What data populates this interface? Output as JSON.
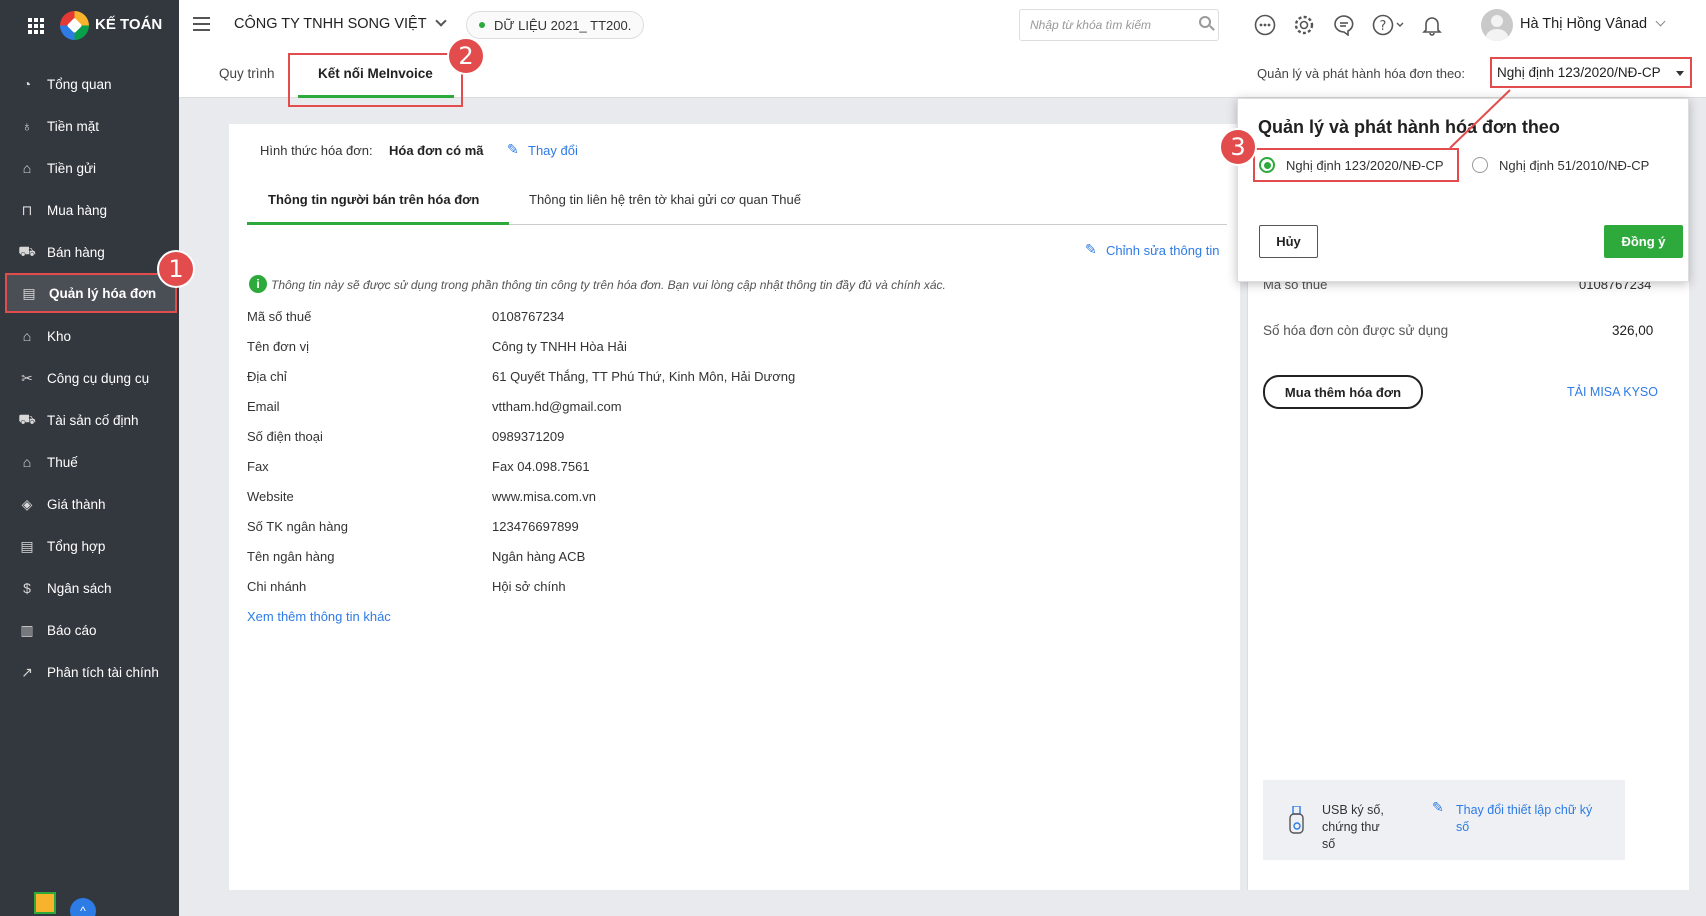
{
  "app": {
    "brand": "KẾ TOÁN"
  },
  "sidebar": {
    "items": [
      {
        "label": "Tổng quan",
        "icon": "dashboard-icon",
        "glyph": "◔"
      },
      {
        "label": "Tiền mặt",
        "icon": "cash-icon",
        "glyph": "♁"
      },
      {
        "label": "Tiền gửi",
        "icon": "bank-icon",
        "glyph": "⌂"
      },
      {
        "label": "Mua hàng",
        "icon": "shopping-bag-icon",
        "glyph": "⊓"
      },
      {
        "label": "Bán hàng",
        "icon": "cart-icon",
        "glyph": "⛟"
      },
      {
        "label": "Quản lý hóa đơn",
        "icon": "invoice-icon",
        "glyph": "▤"
      },
      {
        "label": "Kho",
        "icon": "warehouse-icon",
        "glyph": "⌂"
      },
      {
        "label": "Công cụ dụng cụ",
        "icon": "tools-icon",
        "glyph": "✂"
      },
      {
        "label": "Tài sản cố định",
        "icon": "asset-icon",
        "glyph": "⛟"
      },
      {
        "label": "Thuế",
        "icon": "tax-icon",
        "glyph": "⌂"
      },
      {
        "label": "Giá thành",
        "icon": "price-tag-icon",
        "glyph": "◈"
      },
      {
        "label": "Tổng hợp",
        "icon": "summary-icon",
        "glyph": "▤"
      },
      {
        "label": "Ngân sách",
        "icon": "budget-icon",
        "glyph": "$"
      },
      {
        "label": "Báo cáo",
        "icon": "report-icon",
        "glyph": "▥"
      },
      {
        "label": "Phân tích tài chính",
        "icon": "analytics-icon",
        "glyph": "↗"
      }
    ]
  },
  "header": {
    "company": "CÔNG TY TNHH SONG VIỆT",
    "dataset": "DỮ LIỆU 2021_ TT200.",
    "search_placeholder": "Nhập từ khóa tìm kiếm",
    "user_name": "Hà Thị Hồng Vânad"
  },
  "subbar": {
    "tabs": [
      {
        "label": "Quy trình"
      },
      {
        "label": "Kết nối MeInvoice"
      }
    ],
    "regulation_label": "Quản lý và phát hành hóa đơn theo:",
    "regulation_value": "Nghị định 123/2020/NĐ-CP"
  },
  "card": {
    "invoice_form_label": "Hình thức hóa đơn:",
    "invoice_form_value": "Hóa đơn có mã",
    "change_link": "Thay đổi",
    "tabs": [
      {
        "label": "Thông tin người bán trên hóa đơn"
      },
      {
        "label": "Thông tin liên hệ trên tờ khai gửi cơ quan Thuế"
      }
    ],
    "edit_link": "Chỉnh sửa thông tin",
    "notice": "Thông tin này sẽ được sử dụng trong phần thông tin công ty trên hóa đơn. Bạn vui lòng cập nhật thông tin đầy đủ và chính xác.",
    "fields": [
      {
        "label": "Mã số thuế",
        "value": "0108767234"
      },
      {
        "label": "Tên đơn vị",
        "value": "Công ty TNHH Hòa Hải"
      },
      {
        "label": "Địa chỉ",
        "value": "61 Quyết Thắng, TT Phú Thứ, Kinh Môn, Hải Dương"
      },
      {
        "label": "Email",
        "value": "vttham.hd@gmail.com"
      },
      {
        "label": "Số điện thoại",
        "value": "0989371209"
      },
      {
        "label": "Fax",
        "value": "Fax 04.098.7561"
      },
      {
        "label": "Website",
        "value": "www.misa.com.vn"
      },
      {
        "label": "Số TK ngân hàng",
        "value": "123476697899"
      },
      {
        "label": "Tên ngân hàng",
        "value": "Ngân hàng ACB"
      },
      {
        "label": "Chi nhánh",
        "value": "Hội sở chính"
      }
    ],
    "more_link": "Xem thêm thông tin khác"
  },
  "right": {
    "tax_code_label": "Mã số thuế",
    "tax_code_value": "0108767234",
    "remaining_label": "Số hóa đơn còn được sử dụng",
    "remaining_value": "326,00",
    "buy_button": "Mua thêm hóa đơn",
    "kyso_link": "TẢI MISA KYSO",
    "usb_label": "USB ký số, chứng thư số",
    "change_sig_link": "Thay đổi thiết lập chữ ký số"
  },
  "popup": {
    "title": "Quản lý và phát hành hóa đơn theo",
    "options": [
      {
        "label": "Nghị định 123/2020/NĐ-CP",
        "selected": true
      },
      {
        "label": "Nghị định 51/2010/NĐ-CP",
        "selected": false
      }
    ],
    "cancel": "Hủy",
    "confirm": "Đồng ý"
  },
  "annotations": [
    "1",
    "2",
    "3"
  ],
  "colors": {
    "accent": "#2eaa3c",
    "link": "#2d7be5",
    "highlight": "#e24c4c",
    "sidebar": "#33373e"
  }
}
